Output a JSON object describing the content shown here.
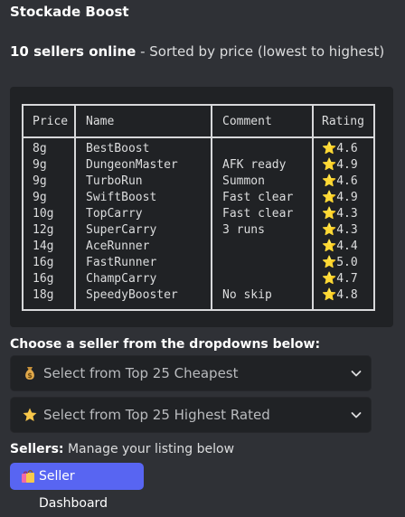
{
  "header": {
    "title": "Stockade Boost",
    "online_count": "10 sellers online",
    "separator": " - ",
    "sort_note": "Sorted by price (lowest to highest)"
  },
  "table": {
    "headers": [
      "Price",
      "Name",
      "Comment",
      "Rating"
    ],
    "rows": [
      {
        "price": "8g",
        "name": "BestBoost",
        "comment": "",
        "star": "⭐",
        "rating": "4.6"
      },
      {
        "price": "9g",
        "name": "DungeonMaster",
        "comment": "AFK ready",
        "star": "⭐",
        "rating": "4.9"
      },
      {
        "price": "9g",
        "name": "TurboRun",
        "comment": "Summon",
        "star": "⭐",
        "rating": "4.6"
      },
      {
        "price": "9g",
        "name": "SwiftBoost",
        "comment": "Fast clear",
        "star": "⭐",
        "rating": "4.9"
      },
      {
        "price": "10g",
        "name": "TopCarry",
        "comment": "Fast clear",
        "star": "⭐",
        "rating": "4.3"
      },
      {
        "price": "12g",
        "name": "SuperCarry",
        "comment": "3 runs",
        "star": "⭐",
        "rating": "4.3"
      },
      {
        "price": "14g",
        "name": "AceRunner",
        "comment": "",
        "star": "⭐",
        "rating": "4.4"
      },
      {
        "price": "16g",
        "name": "FastRunner",
        "comment": "",
        "star": "⭐",
        "rating": "5.0"
      },
      {
        "price": "16g",
        "name": "ChampCarry",
        "comment": "",
        "star": "⭐",
        "rating": "4.7"
      },
      {
        "price": "18g",
        "name": "SpeedyBooster",
        "comment": "No skip",
        "star": "⭐",
        "rating": "4.8"
      }
    ]
  },
  "choose_text": "Choose a seller from the dropdowns below:",
  "dropdowns": [
    {
      "icon": "money-bag-icon",
      "placeholder": "Select from Top 25 Cheapest"
    },
    {
      "icon": "star-icon",
      "placeholder": "Select from Top 25 Highest Rated"
    }
  ],
  "sellers_note": {
    "label": "Sellers:",
    "text": " Manage your listing below"
  },
  "dashboard_button": {
    "icon": "shopping-bags-icon",
    "label": "Seller Dashboard"
  },
  "colors": {
    "background": "#2f3136",
    "codeblock": "#202225",
    "button": "#5865f2"
  }
}
